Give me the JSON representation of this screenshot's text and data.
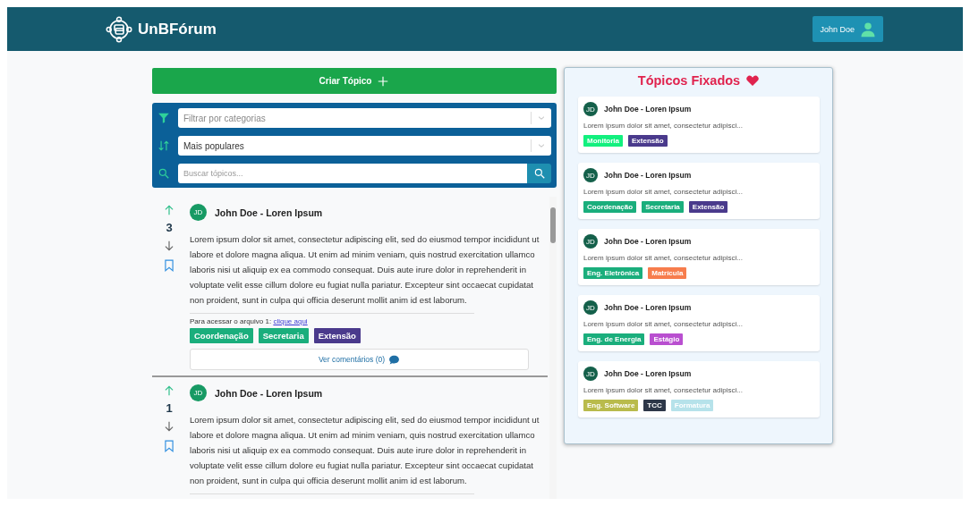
{
  "header": {
    "logo_text": "UnBFórum",
    "user_button": "John Doe"
  },
  "create_button": "Criar Tópico",
  "filters": {
    "category": {
      "placeholder": "Filtrar por categorias"
    },
    "sort": {
      "value": "Mais populares"
    },
    "search": {
      "placeholder": "Buscar tópicos..."
    }
  },
  "posts": [
    {
      "avatar": "JD",
      "title": "John Doe - Loren Ipsum",
      "votes": "3",
      "body": "Lorem ipsum dolor sit amet, consectetur adipiscing elit, sed do eiusmod tempor incididunt ut labore et dolore magna aliqua. Ut enim ad minim veniam, quis nostrud exercitation ullamco laboris nisi ut aliquip ex ea commodo consequat. Duis aute irure dolor in reprehenderit in voluptate velit esse cillum dolore eu fugiat nulla pariatur. Excepteur sint occaecat cupidatat non proident, sunt in culpa qui officia deserunt mollit anim id est laborum.",
      "file_text": "Para acessar o arquivo 1:",
      "file_link": "clique aqui",
      "tags": [
        {
          "label": "Coordenação",
          "color": "#1aae7c"
        },
        {
          "label": "Secretaria",
          "color": "#1aae7c"
        },
        {
          "label": "Extensão",
          "color": "#4a3a8c"
        }
      ],
      "comments_button": "Ver comentários (0)"
    },
    {
      "avatar": "JD",
      "title": "John Doe - Loren Ipsum",
      "votes": "1",
      "body": "Lorem ipsum dolor sit amet, consectetur adipiscing elit, sed do eiusmod tempor incididunt ut labore et dolore magna aliqua. Ut enim ad minim veniam, quis nostrud exercitation ullamco laboris nisi ut aliquip ex ea commodo consequat. Duis aute irure dolor in reprehenderit in voluptate velit esse cillum dolore eu fugiat nulla pariatur. Excepteur sint occaecat cupidatat non proident, sunt in culpa qui officia deserunt mollit anim id est laborum."
    }
  ],
  "pinned": {
    "title": "Tópicos Fixados",
    "topics": [
      {
        "avatar": "JD",
        "title": "John Doe - Loren Ipsum",
        "excerpt": "Lorem ipsum dolor sit amet, consectetur adipisci...",
        "tags": [
          {
            "label": "Monitoria",
            "color": "#12f07e"
          },
          {
            "label": "Extensão",
            "color": "#4a3a8c"
          }
        ]
      },
      {
        "avatar": "JD",
        "title": "John Doe - Loren Ipsum",
        "excerpt": "Lorem ipsum dolor sit amet, consectetur adipisci...",
        "tags": [
          {
            "label": "Coordenação",
            "color": "#1aae7c"
          },
          {
            "label": "Secretaria",
            "color": "#1aae7c"
          },
          {
            "label": "Extensão",
            "color": "#4a3a8c"
          }
        ]
      },
      {
        "avatar": "JD",
        "title": "John Doe - Loren Ipsum",
        "excerpt": "Lorem ipsum dolor sit amet, consectetur adipisci...",
        "tags": [
          {
            "label": "Eng. Eletrônica",
            "color": "#1aae7c"
          },
          {
            "label": "Matrícula",
            "color": "#f77d4d"
          }
        ]
      },
      {
        "avatar": "JD",
        "title": "John Doe - Loren Ipsum",
        "excerpt": "Lorem ipsum dolor sit amet, consectetur adipisci...",
        "tags": [
          {
            "label": "Eng. de Energia",
            "color": "#1aae7c"
          },
          {
            "label": "Estágio",
            "color": "#b94fd0"
          }
        ]
      },
      {
        "avatar": "JD",
        "title": "John Doe - Loren Ipsum",
        "excerpt": "Lorem ipsum dolor sit amet, consectetur adipisci...",
        "tags": [
          {
            "label": "Eng. Software",
            "color": "#b9bb4c"
          },
          {
            "label": "TCC",
            "color": "#2d3748"
          },
          {
            "label": "Formatura",
            "color": "#b6e2ea"
          }
        ]
      }
    ]
  }
}
